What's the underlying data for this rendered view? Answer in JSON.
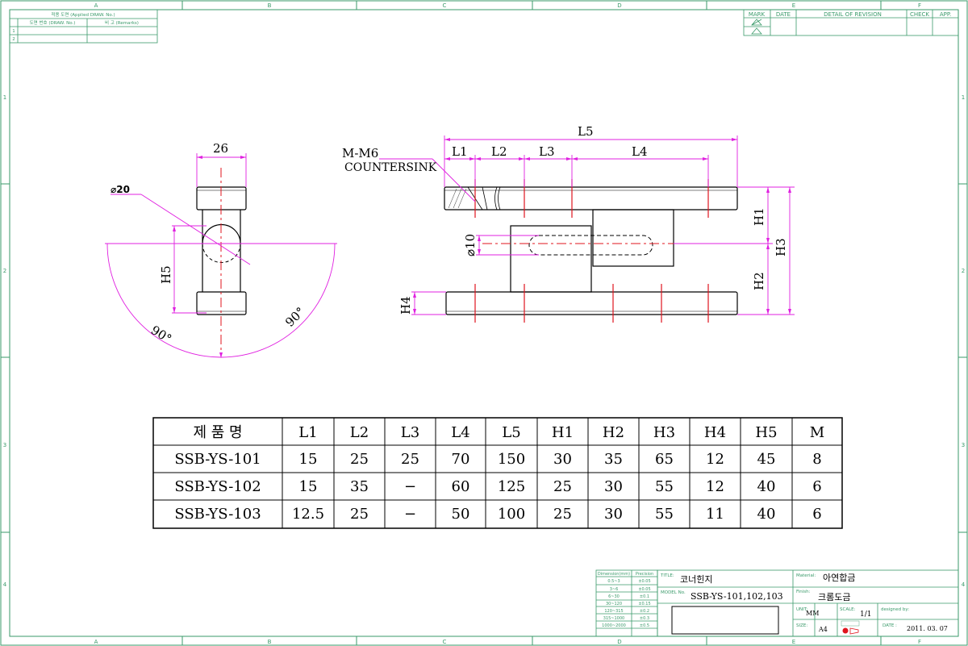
{
  "border": {
    "cols": [
      "A",
      "B",
      "C",
      "D",
      "E",
      "F"
    ],
    "rows": [
      "1",
      "2",
      "3",
      "4"
    ]
  },
  "applied_box": {
    "header": "적용 도면 (Applied DRAW. No.)",
    "col1": "도면 번호 (DRAW. No.)",
    "col2": "비 고 (Remarks)",
    "row_nums": [
      "1",
      "2"
    ]
  },
  "revision_box": {
    "headers": [
      "MARK",
      "DATE",
      "DETAIL OF REVISION",
      "CHECK",
      "APP."
    ]
  },
  "drawing": {
    "dim_26": "26",
    "dia_20": "⌀20",
    "h5": "H5",
    "angle1": "90°",
    "angle2": "90°",
    "m_label": "M-M6",
    "countersink": "COUNTERSINK",
    "l5": "L5",
    "l1": "L1",
    "l2": "L2",
    "l3": "L3",
    "l4": "L4",
    "h1": "H1",
    "h2": "H2",
    "h3": "H3",
    "h4": "H4",
    "dia_10": "⌀10"
  },
  "spec_table": {
    "headers": [
      "제 품 명",
      "L1",
      "L2",
      "L3",
      "L4",
      "L5",
      "H1",
      "H2",
      "H3",
      "H4",
      "H5",
      "M"
    ],
    "rows": [
      [
        "SSB-YS-101",
        "15",
        "25",
        "25",
        "70",
        "150",
        "30",
        "35",
        "65",
        "12",
        "45",
        "8"
      ],
      [
        "SSB-YS-102",
        "15",
        "35",
        "−",
        "60",
        "125",
        "25",
        "30",
        "55",
        "12",
        "40",
        "6"
      ],
      [
        "SSB-YS-103",
        "12.5",
        "25",
        "−",
        "50",
        "100",
        "25",
        "30",
        "55",
        "11",
        "40",
        "6"
      ]
    ]
  },
  "tolerance": {
    "headers": [
      "Dimension(mm)",
      "Precision"
    ],
    "rows": [
      [
        "0.5~3",
        "±0.05"
      ],
      [
        "3~6",
        "±0.05"
      ],
      [
        "6~30",
        "±0.1"
      ],
      [
        "30~120",
        "±0.15"
      ],
      [
        "120~315",
        "±0.2"
      ],
      [
        "315~1000",
        "±0.3"
      ],
      [
        "1000~2000",
        "±0.5"
      ]
    ]
  },
  "title_block": {
    "title_label": "TITLE:",
    "title_value": "코너힌지",
    "model_label": "MODEL No.",
    "model_value": "SSB-YS-101,102,103",
    "material_label": "Material:",
    "material_value": "아연합금",
    "finish_label": "Finish:",
    "finish_value": "크롬도금",
    "unit_label": "UNIT:",
    "unit_value": "MM",
    "scale_label": "SCALE:",
    "scale_value": "1/1",
    "designed_label": "designed by:",
    "size_label": "SIZE:",
    "size_value": "A4",
    "date_label": "DATE :",
    "date_value": "2011. 03. 07"
  }
}
